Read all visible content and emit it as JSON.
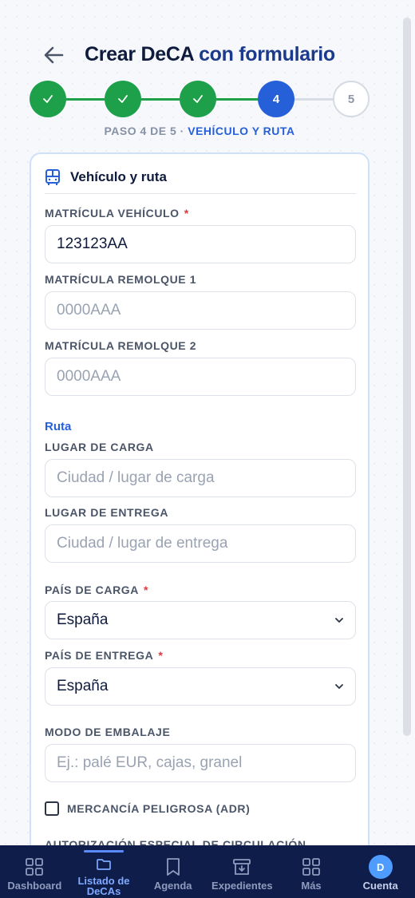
{
  "header": {
    "title_part1": "Crear DeCA",
    "title_part2": "con formulario"
  },
  "stepper": {
    "steps": [
      {
        "label": "✓",
        "state": "done"
      },
      {
        "label": "✓",
        "state": "done"
      },
      {
        "label": "✓",
        "state": "done"
      },
      {
        "label": "4",
        "state": "active"
      },
      {
        "label": "5",
        "state": "todo"
      }
    ],
    "caption_prefix": "PASO 4 DE 5 ·",
    "caption_step": "VEHÍCULO Y RUTA"
  },
  "card": {
    "heading": "Vehículo y ruta",
    "heading_icon": "bus-icon",
    "fields": {
      "matricula_vehiculo": {
        "label": "MATRÍCULA VEHÍCULO",
        "required_mark": "*",
        "value": "123123AA",
        "placeholder": ""
      },
      "matricula_remolque1": {
        "label": "MATRÍCULA REMOLQUE 1",
        "value": "",
        "placeholder": "0000AAA"
      },
      "matricula_remolque2": {
        "label": "MATRÍCULA REMOLQUE 2",
        "value": "",
        "placeholder": "0000AAA"
      },
      "lugar_carga": {
        "label": "LUGAR DE CARGA",
        "value": "",
        "placeholder": "Ciudad / lugar de carga"
      },
      "lugar_entrega": {
        "label": "LUGAR DE ENTREGA",
        "value": "",
        "placeholder": "Ciudad / lugar de entrega"
      },
      "pais_carga": {
        "label": "PAÍS DE CARGA",
        "required_mark": "*",
        "selected": "España"
      },
      "pais_entrega": {
        "label": "PAÍS DE ENTREGA",
        "required_mark": "*",
        "selected": "España"
      },
      "modo_embalaje": {
        "label": "MODO DE EMBALAJE",
        "value": "",
        "placeholder": "Ej.: palé EUR, cajas, granel"
      }
    },
    "ruta_section": "Ruta",
    "mercancia_peligrosa": {
      "label": "MERCANCÍA PELIGROSA (ADR)",
      "checked": false
    },
    "cut_label": "AUTORIZACIÓN ESPECIAL DE CIRCULACIÓN"
  },
  "bottom_nav": {
    "items": [
      {
        "label": "Dashboard",
        "icon": "grid-icon"
      },
      {
        "label": "Listado de DeCAs",
        "icon": "folder-icon",
        "active": true
      },
      {
        "label": "Agenda",
        "icon": "bookmark-icon"
      },
      {
        "label": "Expedientes",
        "icon": "archive-icon"
      },
      {
        "label": "Más",
        "icon": "grid-icon"
      },
      {
        "label": "Cuenta",
        "icon": "avatar",
        "avatar_letter": "D"
      }
    ]
  },
  "colors": {
    "accent": "#2660d9",
    "success": "#1e9f4a",
    "nav_bg": "#0f1d4a",
    "required": "#e0393e"
  }
}
